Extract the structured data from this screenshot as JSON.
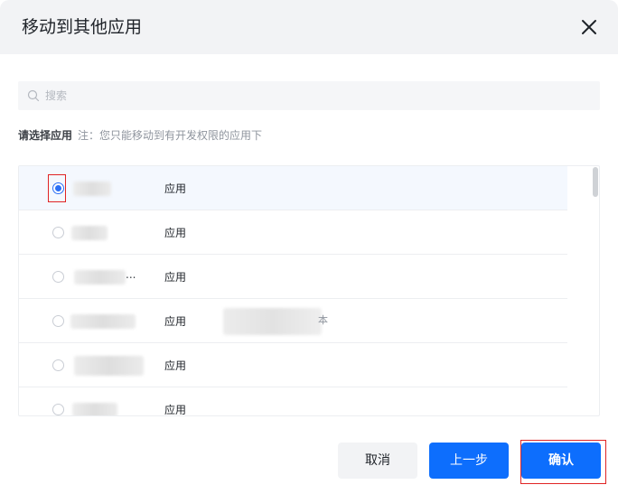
{
  "dialog": {
    "title": "移动到其他应用",
    "close_icon": "close-icon"
  },
  "search": {
    "placeholder": "搜索",
    "value": "",
    "icon": "search-icon"
  },
  "selection": {
    "label": "请选择应用",
    "note": "注：您只能移动到有开发权限的应用下"
  },
  "list": {
    "items": [
      {
        "name_blurred": true,
        "type": "应用",
        "selected": true,
        "trailing": ""
      },
      {
        "name_blurred": true,
        "type": "应用",
        "selected": false,
        "trailing": ""
      },
      {
        "name_blurred": true,
        "type": "应用",
        "selected": false,
        "trailing": "..."
      },
      {
        "name_blurred": true,
        "type": "应用",
        "selected": false,
        "trailing": ""
      },
      {
        "name_blurred": true,
        "type": "应用",
        "selected": false,
        "trailing": ""
      },
      {
        "name_blurred": true,
        "type": "应用",
        "selected": false,
        "trailing": ""
      }
    ],
    "extra_glyph": "本"
  },
  "footer": {
    "cancel_label": "取消",
    "prev_label": "上一步",
    "confirm_label": "确认"
  },
  "colors": {
    "primary": "#0d6efd",
    "selected_row": "#f4f8fe",
    "annotation": "#e02424"
  }
}
